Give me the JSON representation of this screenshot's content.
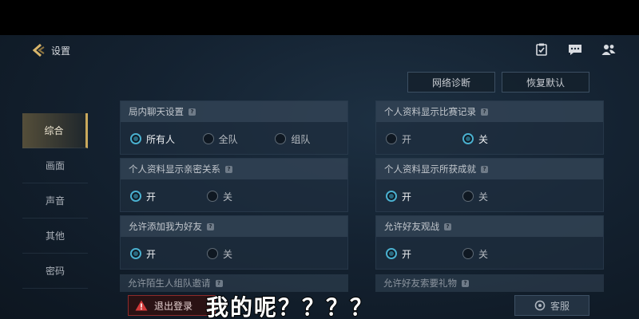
{
  "header": {
    "title": "设置",
    "icons": [
      "clipboard-check-icon",
      "chat-icon",
      "friends-icon"
    ]
  },
  "top_buttons": {
    "network": "网络诊断",
    "restore": "恢复默认"
  },
  "sidebar": {
    "items": [
      {
        "label": "综合",
        "active": true
      },
      {
        "label": "画面",
        "active": false
      },
      {
        "label": "声音",
        "active": false
      },
      {
        "label": "其他",
        "active": false
      },
      {
        "label": "密码",
        "active": false
      }
    ]
  },
  "settings": [
    {
      "title": "局内聊天设置",
      "options": [
        "所有人",
        "全队",
        "组队"
      ],
      "selected": 0
    },
    {
      "title": "个人资料显示比赛记录",
      "options": [
        "开",
        "关"
      ],
      "selected": 1
    },
    {
      "title": "个人资料显示亲密关系",
      "options": [
        "开",
        "关"
      ],
      "selected": 0
    },
    {
      "title": "个人资料显示所获成就",
      "options": [
        "开",
        "关"
      ],
      "selected": 0
    },
    {
      "title": "允许添加我为好友",
      "options": [
        "开",
        "关"
      ],
      "selected": 0
    },
    {
      "title": "允许好友观战",
      "options": [
        "开",
        "关"
      ],
      "selected": 0
    }
  ],
  "partial": {
    "left": "允许陌生人组队邀请",
    "right": "允许好友索要礼物"
  },
  "bottom": {
    "logout": "退出登录",
    "service": "客服"
  },
  "caption": "我的呢？？？？",
  "colors": {
    "accent": "#4ab0cf",
    "active_gold": "#c9a85c",
    "logout_red": "#8e2a2a"
  }
}
